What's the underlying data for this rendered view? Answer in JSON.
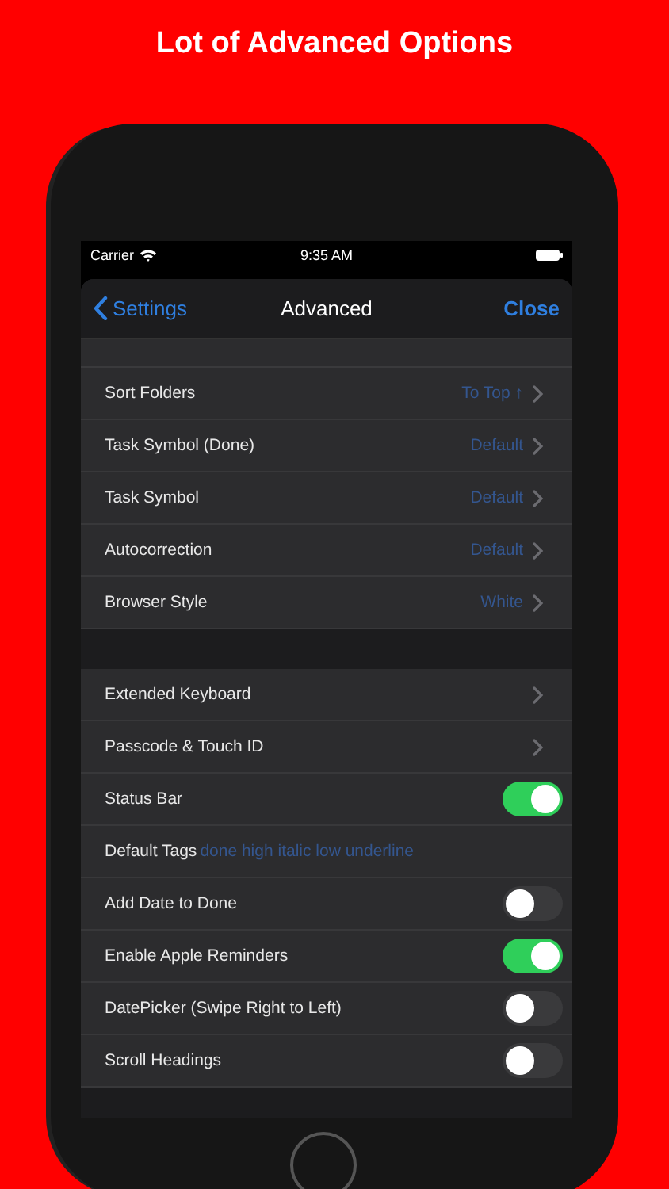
{
  "headline": "Lot of Advanced Options",
  "status_bar": {
    "carrier": "Carrier",
    "time": "9:35 AM"
  },
  "nav": {
    "back": "Settings",
    "title": "Advanced",
    "action": "Close"
  },
  "groups": [
    {
      "rows": [
        {
          "kind": "link",
          "label": "Sort Folders",
          "value": "To Top ↑"
        },
        {
          "kind": "link",
          "label": "Task Symbol (Done)",
          "value": "Default"
        },
        {
          "kind": "link",
          "label": "Task Symbol",
          "value": "Default"
        },
        {
          "kind": "link",
          "label": "Autocorrection",
          "value": "Default"
        },
        {
          "kind": "link",
          "label": "Browser Style",
          "value": "White"
        }
      ]
    },
    {
      "rows": [
        {
          "kind": "link",
          "label": "Extended Keyboard"
        },
        {
          "kind": "link",
          "label": "Passcode & Touch ID"
        },
        {
          "kind": "toggle",
          "label": "Status Bar",
          "on": true
        },
        {
          "kind": "tags",
          "label": "Default Tags",
          "value": "done high italic low underline"
        },
        {
          "kind": "toggle",
          "label": "Add Date to Done",
          "on": false
        },
        {
          "kind": "toggle",
          "label": "Enable Apple Reminders",
          "on": true
        },
        {
          "kind": "toggle",
          "label": "DatePicker (Swipe Right to Left)",
          "on": false
        },
        {
          "kind": "toggle",
          "label": "Scroll Headings",
          "on": false
        }
      ]
    }
  ]
}
